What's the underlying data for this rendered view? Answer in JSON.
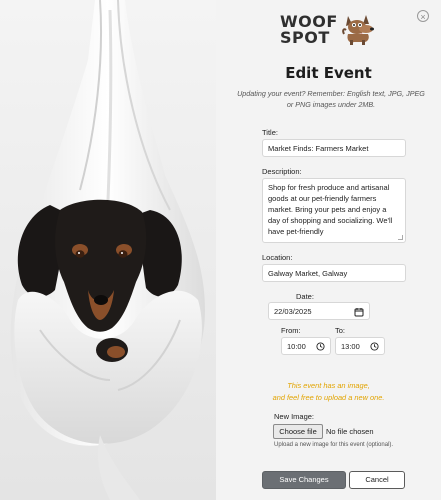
{
  "brand": {
    "line1": "WOOF",
    "line2": "SPOT"
  },
  "page": {
    "title": "Edit Event",
    "subtitle": "Updating your event? Remember: English text, JPG, JPEG or PNG images under 2MB."
  },
  "form": {
    "title_label": "Title:",
    "title_value": "Market Finds: Farmers Market",
    "description_label": "Description:",
    "description_value": "Shop for fresh produce and artisanal goods at our pet-friendly farmers market. Bring your pets and enjoy a day of shopping and socializing. We'll have pet-friendly",
    "location_label": "Location:",
    "location_value": "Galway Market, Galway",
    "date_label": "Date:",
    "date_value": "22/03/2025",
    "from_label": "From:",
    "from_value": "10:00",
    "to_label": "To:",
    "to_value": "13:00",
    "image_notice_line1": "This event has an image,",
    "image_notice_line2": "and feel free to upload a new one.",
    "new_image_label": "New Image:",
    "file_button_label": "Choose file",
    "file_status": "No file chosen",
    "file_help": "Upload a new image for this event (optional).",
    "save_label": "Save Changes",
    "cancel_label": "Cancel",
    "close_glyph": "×"
  },
  "colors": {
    "notice": "#e2a400",
    "save_button": "#6b6f74",
    "background": "#f3f3f3"
  },
  "icons": {
    "close": "close-circle-icon",
    "calendar": "calendar-icon",
    "clock": "clock-icon"
  }
}
